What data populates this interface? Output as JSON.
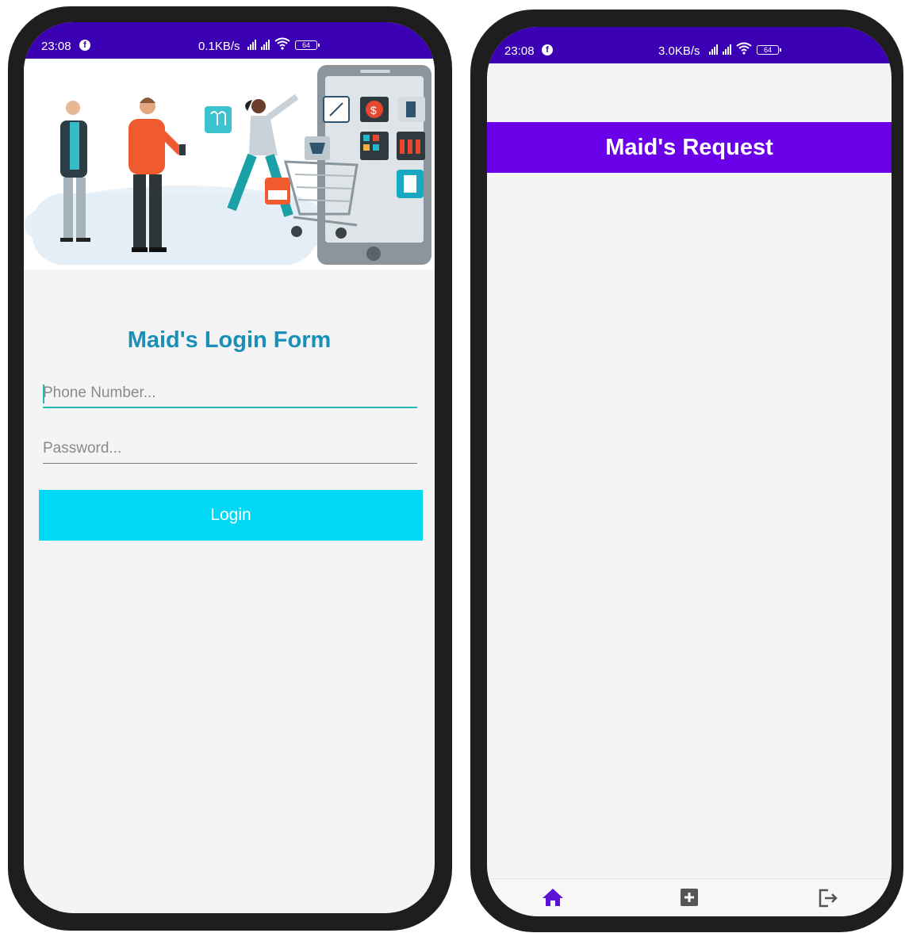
{
  "left_phone": {
    "status": {
      "time": "23:08",
      "speed": "0.1KB/s",
      "battery": "64"
    },
    "login_form": {
      "title": "Maid's Login Form",
      "phone_placeholder": "Phone Number...",
      "password_placeholder": "Password...",
      "login_label": "Login"
    }
  },
  "right_phone": {
    "status": {
      "time": "23:08",
      "speed": "3.0KB/s",
      "battery": "64"
    },
    "header_title": "Maid's Request",
    "bottom_nav": {
      "items": [
        {
          "icon": "home-icon",
          "active": true
        },
        {
          "icon": "add-box-icon",
          "active": false
        },
        {
          "icon": "logout-icon",
          "active": false
        }
      ]
    }
  },
  "colors": {
    "status_bar": "#3b00b3",
    "title_teal": "#1b8fb8",
    "field_focus": "#21b8b8",
    "login_button": "#00d9f5",
    "request_header": "#6a00e8",
    "nav_active": "#5b12d6",
    "nav_inactive": "#555555"
  }
}
